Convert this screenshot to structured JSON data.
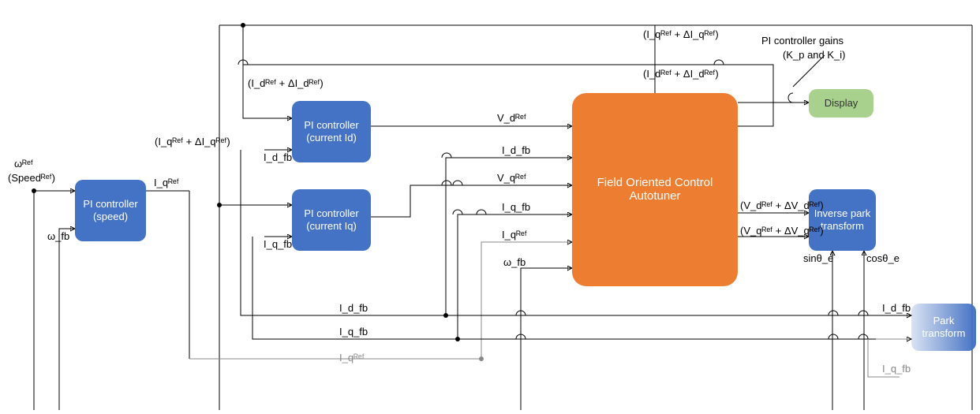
{
  "blocks": {
    "pi_speed": "PI controller (speed)",
    "pi_id": "PI controller (current Id)",
    "pi_iq": "PI controller (current Iq)",
    "foc_autotuner": "Field Oriented Control Autotuner",
    "display": "Display",
    "inverse_park": "Inverse park transform",
    "park": "Park transform"
  },
  "labels": {
    "omega_ref": "ωᴿᵉᶠ",
    "speed_ref": "(Speedᴿᵉᶠ)",
    "omega_fb": "ω_fb",
    "iq_ref": "I_qᴿᵉᶠ",
    "iq_ref_delta": "(I_qᴿᵉᶠ + ΔI_qᴿᵉᶠ)",
    "id_ref_delta": "(I_dᴿᵉᶠ + ΔI_dᴿᵉᶠ)",
    "id_fb": "I_d_fb",
    "iq_fb": "I_q_fb",
    "vd_ref": "V_dᴿᵉᶠ",
    "vq_ref": "V_qᴿᵉᶠ",
    "vd_ref_delta": "(V_dᴿᵉᶠ + ΔV_dᴿᵉᶠ)",
    "vq_ref_delta": "(V_qᴿᵉᶠ + ΔV_qᴿᵉᶠ)",
    "sin_theta": "sinθ_e",
    "cos_theta": "cosθ_e",
    "pi_gains_line1": "PI controller gains",
    "pi_gains_line2": "(K_p and K_i)"
  }
}
